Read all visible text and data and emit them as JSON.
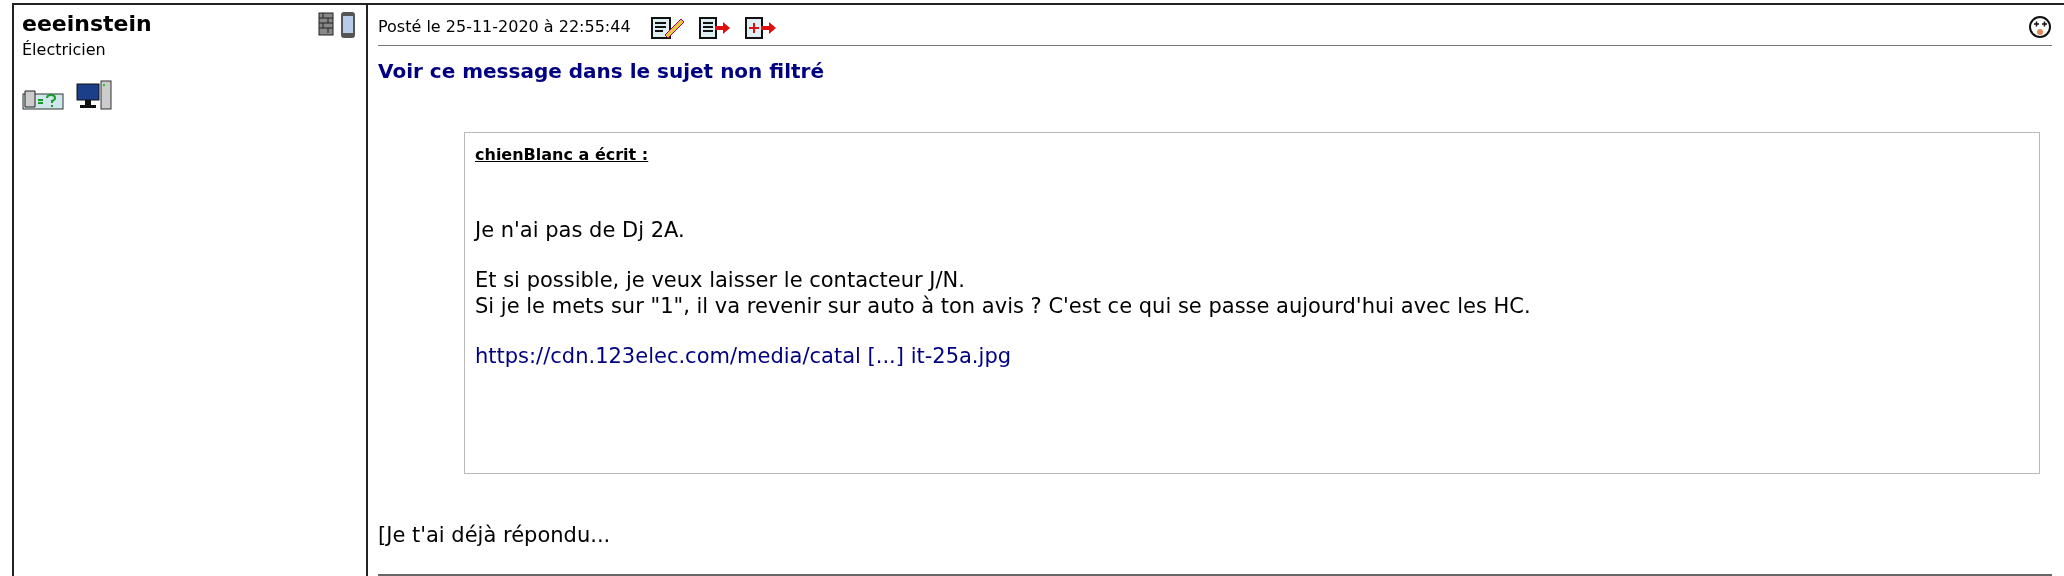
{
  "author": {
    "name": "eeeinstein",
    "role": "Électricien"
  },
  "post": {
    "date": "Posté le 25-11-2020 à 22:55:44",
    "filter_link": "Voir ce message dans le sujet non filtré",
    "quote": {
      "author": "chienBlanc a écrit :",
      "paragraphs": [
        {
          "kind": "text",
          "lines": [
            "Je n'ai pas de Dj 2A."
          ]
        },
        {
          "kind": "text",
          "lines": [
            "Et si possible, je veux laisser le contacteur J/N.",
            "Si je le mets sur \"1\", il va revenir sur auto à ton avis ? C'est ce qui se passe aujourd'hui avec les HC."
          ]
        },
        {
          "kind": "link",
          "lines": [
            "https://cdn.123elec.com/media/catal [...] it-25a.jpg"
          ]
        }
      ]
    },
    "reply": "[Je t'ai déjà répondu..."
  }
}
